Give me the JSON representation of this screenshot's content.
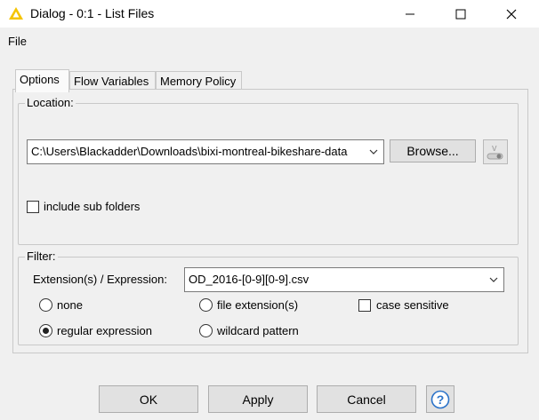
{
  "window": {
    "title": "Dialog - 0:1 - List Files",
    "controls": {
      "minimize": "minimize",
      "maximize": "maximize",
      "close": "close"
    }
  },
  "menu": {
    "file": "File"
  },
  "tabs": [
    {
      "label": "Options"
    },
    {
      "label": "Flow Variables"
    },
    {
      "label": "Memory Policy"
    }
  ],
  "location": {
    "group_label": "Location:",
    "path_value": "C:\\Users\\Blackadder\\Downloads\\bixi-montreal-bikeshare-data",
    "browse_label": "Browse...",
    "include_sub_folders_label": "include sub folders",
    "include_sub_folders_checked": false
  },
  "filter": {
    "group_label": "Filter:",
    "expression_label": "Extension(s) / Expression:",
    "expression_value": "OD_2016-[0-9][0-9].csv",
    "options": {
      "none": "none",
      "file_extension": "file extension(s)",
      "regular_expression": "regular expression",
      "wildcard_pattern": "wildcard pattern"
    },
    "selected": "regular_expression",
    "case_sensitive_label": "case sensitive",
    "case_sensitive_checked": false
  },
  "buttons": {
    "ok": "OK",
    "apply": "Apply",
    "cancel": "Cancel"
  },
  "colors": {
    "accent_icon": "#f5c400",
    "help_blue": "#2b73c9"
  }
}
